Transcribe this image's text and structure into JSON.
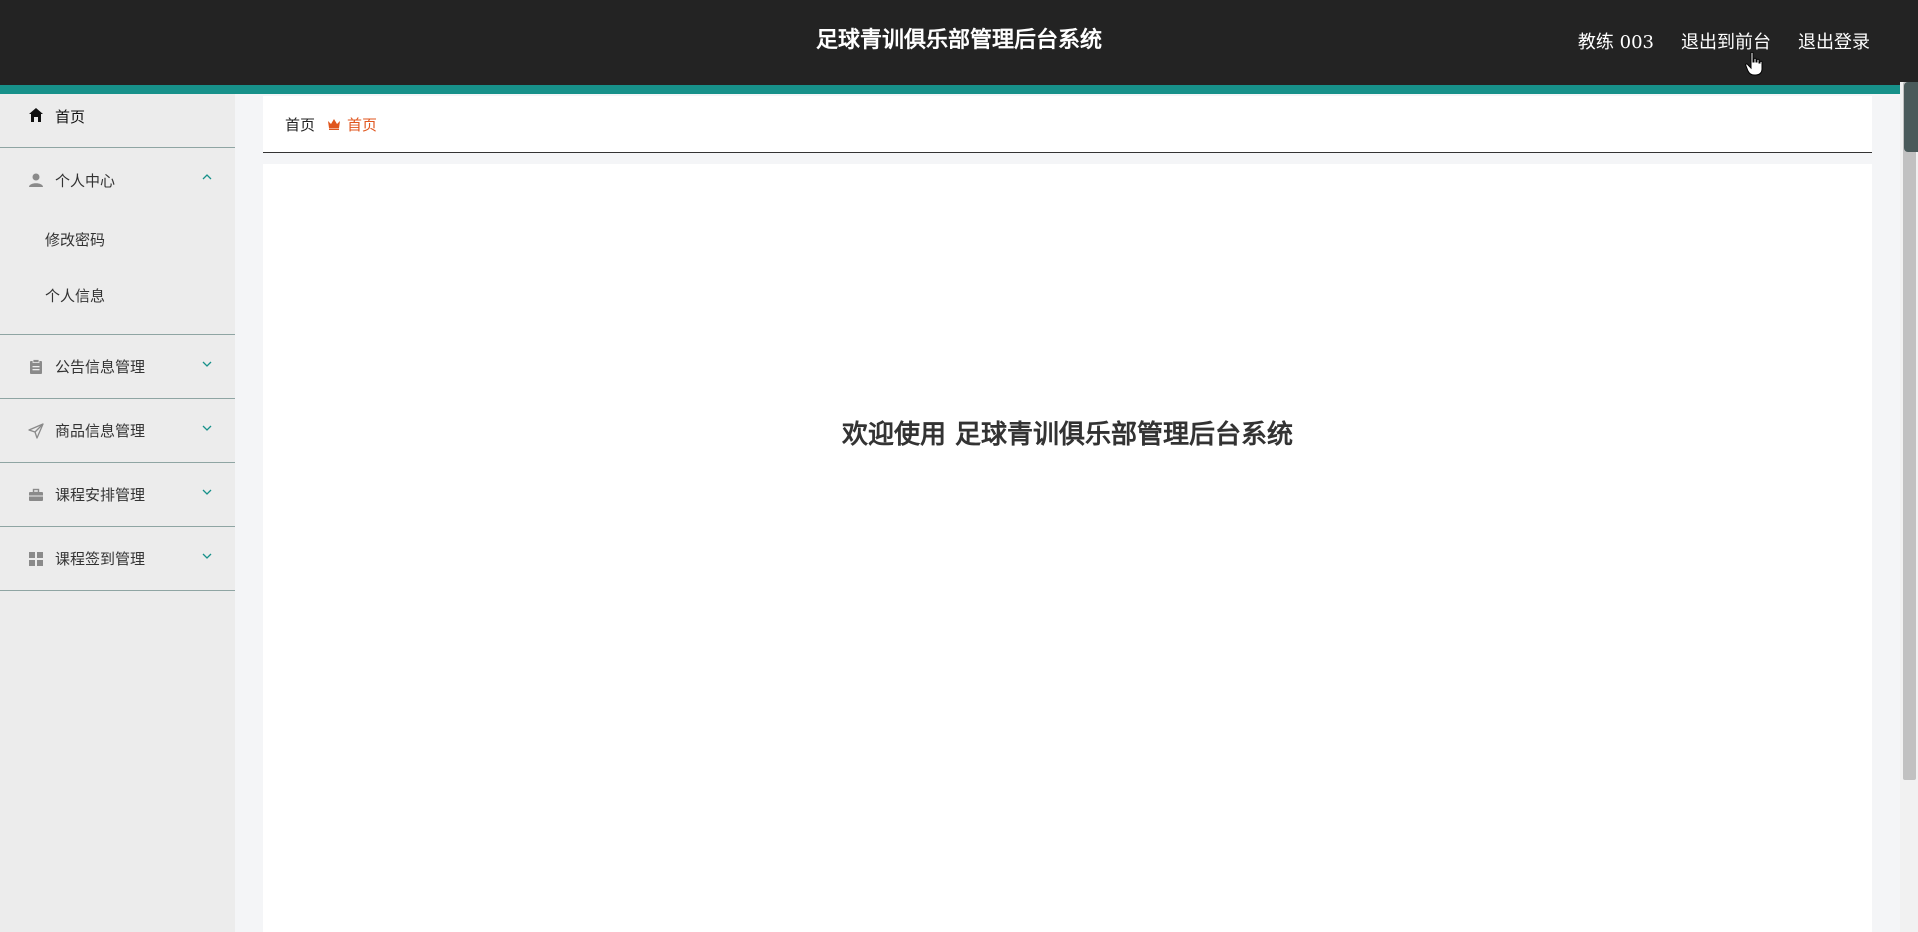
{
  "header": {
    "title": "足球青训俱乐部管理后台系统",
    "user": "教练 003",
    "front_link": "退出到前台",
    "logout": "退出登录"
  },
  "sidebar": {
    "home": "首页",
    "personal_center": {
      "label": "个人中心",
      "children": [
        "修改密码",
        "个人信息"
      ]
    },
    "items": [
      {
        "label": "公告信息管理",
        "icon": "clipboard-icon"
      },
      {
        "label": "商品信息管理",
        "icon": "send-icon"
      },
      {
        "label": "课程安排管理",
        "icon": "briefcase-icon"
      },
      {
        "label": "课程签到管理",
        "icon": "grid-icon"
      }
    ]
  },
  "breadcrumb": {
    "root": "首页",
    "current": "首页"
  },
  "main": {
    "welcome": "欢迎使用 足球青训俱乐部管理后台系统"
  },
  "colors": {
    "header_bg": "#232323",
    "accent": "#17918a",
    "breadcrumb_active": "#e0561e"
  }
}
